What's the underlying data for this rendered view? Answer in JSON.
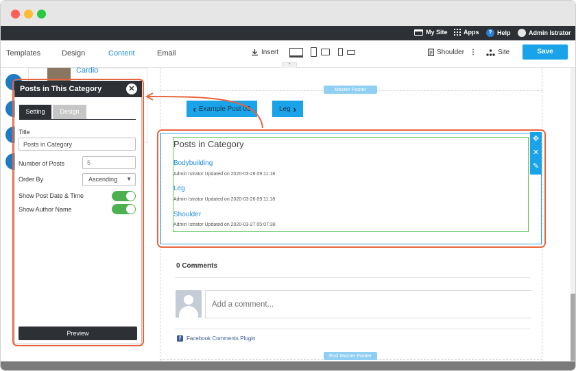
{
  "topbar": {
    "my_site": "My Site",
    "apps": "Apps",
    "help": "Help",
    "user": "Admin Istrator"
  },
  "toolbar": {
    "tabs": [
      "Templates",
      "Design",
      "Content",
      "Email"
    ],
    "active_tab": "Content",
    "insert_label": "Insert",
    "page_label": "Shoulder",
    "site_label": "Site",
    "save_label": "Save"
  },
  "background": {
    "cardio_label": "Cardio"
  },
  "page": {
    "master_footer_label": "Master Footer",
    "end_master_footer_label": "End Master Footer",
    "prev_post_label": "Example Post 03",
    "next_post_label": "Leg"
  },
  "widget": {
    "title": "Posts in Category",
    "posts": [
      {
        "title": "Bodybuilding",
        "meta": "Admin Istrator Updated on 2020-03-26 09:11:18"
      },
      {
        "title": "Leg",
        "meta": "Admin Istrator Updated on 2020-03-26 09:11:18"
      },
      {
        "title": "Shoulder",
        "meta": "Admin Istrator Updated on 2020-03-27 05:07:38"
      }
    ]
  },
  "comments": {
    "title": "0 Comments",
    "placeholder": "Add a comment...",
    "plugin_label": "Facebook Comments Plugin"
  },
  "panel": {
    "title": "Posts in This Category",
    "tab_setting": "Setting",
    "tab_design": "Design",
    "title_label": "Title",
    "title_value": "Posts in Category",
    "num_posts_label": "Number of Posts",
    "num_posts_value": "5",
    "order_by_label": "Order By",
    "order_by_value": "Ascending",
    "show_date_label": "Show Post Date & Time",
    "show_date_on": true,
    "show_author_label": "Show Author Name",
    "show_author_on": true,
    "preview_label": "Preview"
  },
  "colors": {
    "accent": "#1aa3e8",
    "highlight": "#e8643c",
    "toggle_on": "#4caf50",
    "dark": "#2d3135"
  }
}
